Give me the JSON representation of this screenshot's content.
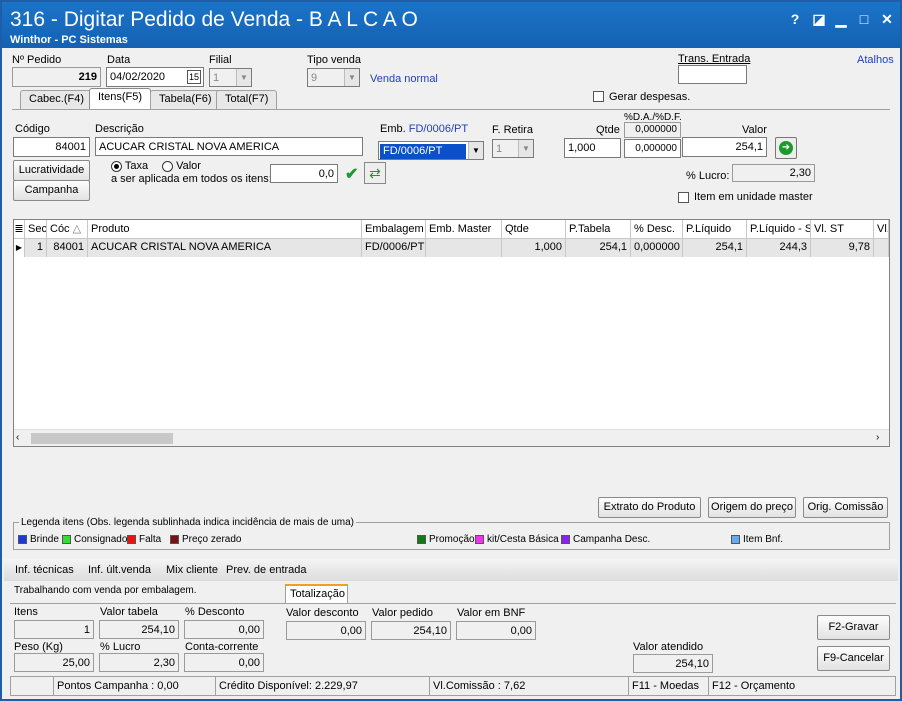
{
  "window": {
    "title": "316 - Digitar Pedido de Venda - B A L C A O",
    "subtitle": "Winthor - PC Sistemas",
    "help": "?",
    "restore": "◪",
    "minimize": "▁",
    "maximize": "□",
    "close": "✕"
  },
  "header": {
    "pedido_label": "Nº Pedido",
    "pedido_value": "219",
    "data_label": "Data",
    "data_value": "04/02/2020",
    "data_icon": "15",
    "filial_label": "Filial",
    "filial_value": "1",
    "tipo_label": "Tipo venda",
    "tipo_value": "9",
    "tipo_text": "Venda normal",
    "trans_label": "Trans. Entrada",
    "atalhos": "Atalhos"
  },
  "tabs": [
    "Cabec.(F4)",
    "Itens(F5)",
    "Tabela(F6)",
    "Total(F7)"
  ],
  "gerar_despesas": "Gerar despesas.",
  "item": {
    "codigo_label": "Código",
    "codigo_value": "84001",
    "descricao_label": "Descrição",
    "descricao_value": "ACUCAR CRISTAL NOVA AMERICA",
    "emb_label": "Emb.",
    "emb_link": "FD/0006/PT",
    "emb_value": "FD/0006/PT",
    "fretira_label": "F. Retira",
    "fretira_value": "1",
    "qtde_label": "Qtde",
    "qtde_value": "1,000",
    "da_label": "%D.A./%D.F.",
    "da_value1": "0,000000",
    "da_value2": "0,000000",
    "valor_label": "Valor",
    "valor_value": "254,1",
    "lucro_label": "% Lucro:",
    "lucro_value": "2,30",
    "item_master": "Item em unidade master",
    "lucratividade": "Lucratividade",
    "campanha": "Campanha",
    "taxa": "Taxa",
    "valor_radio": "Valor",
    "aplicada": "a ser aplicada em todos os itens:",
    "aplicada_value": "0,0"
  },
  "grid": {
    "headers": [
      "Sec",
      "Cóc",
      "Produto",
      "Embalagem",
      "Emb. Master",
      "Qtde",
      "P.Tabela",
      "% Desc.",
      "P.Líquido",
      "P.Líquido - S",
      "Vl. ST",
      "Vl."
    ],
    "row": [
      "1",
      "84001",
      "ACUCAR CRISTAL NOVA AMERICA",
      "FD/0006/PT",
      "",
      "1,000",
      "254,1",
      "0,000000",
      "254,1",
      "244,3",
      "9,78",
      ""
    ]
  },
  "buttons": {
    "extrato": "Extrato do Produto",
    "origem": "Origem do preço",
    "comissao": "Orig. Comissão",
    "gravar": "F2-Gravar",
    "cancelar": "F9-Cancelar"
  },
  "legend": {
    "title": "Legenda itens (Obs. legenda sublinhada indica incidência de mais de uma)",
    "items": [
      {
        "label": "Brinde",
        "color": "#1a3adc"
      },
      {
        "label": "Consignado",
        "color": "#33dd33"
      },
      {
        "label": "Falta",
        "color": "#ee1111"
      },
      {
        "label": "Preço zerado",
        "color": "#7a1010"
      },
      {
        "label": "Promoção",
        "color": "#127a12"
      },
      {
        "label": "kit/Cesta Básica",
        "color": "#ee33ee"
      },
      {
        "label": "Campanha Desc.",
        "color": "#8a22ee"
      },
      {
        "label": "Item Bnf.",
        "color": "#66aaee"
      }
    ]
  },
  "lower_tabs": [
    "Inf. técnicas",
    "Inf. últ.venda",
    "Mix cliente",
    "Prev. de entrada"
  ],
  "working": "Trabalhando com venda por embalagem.",
  "totalizacao_tab": "Totalização",
  "totals": {
    "itens_label": "Itens",
    "itens_value": "1",
    "valor_tabela_label": "Valor tabela",
    "valor_tabela_value": "254,10",
    "pct_desc_label": "% Desconto",
    "pct_desc_value": "0,00",
    "valor_desc_label": "Valor desconto",
    "valor_desc_value": "0,00",
    "valor_pedido_label": "Valor pedido",
    "valor_pedido_value": "254,10",
    "valor_bnf_label": "Valor em BNF",
    "valor_bnf_value": "0,00",
    "peso_label": "Peso (Kg)",
    "peso_value": "25,00",
    "pct_lucro_label": "% Lucro",
    "pct_lucro_value": "2,30",
    "conta_label": "Conta-corrente",
    "conta_value": "0,00",
    "valor_atendido_label": "Valor atendido",
    "valor_atendido_value": "254,10"
  },
  "status": [
    "",
    "Pontos Campanha : 0,00",
    "Crédito Disponível: 2.229,97",
    "Vl.Comissão : 7,62",
    "F11 - Moedas",
    "F12 - Orçamento"
  ]
}
